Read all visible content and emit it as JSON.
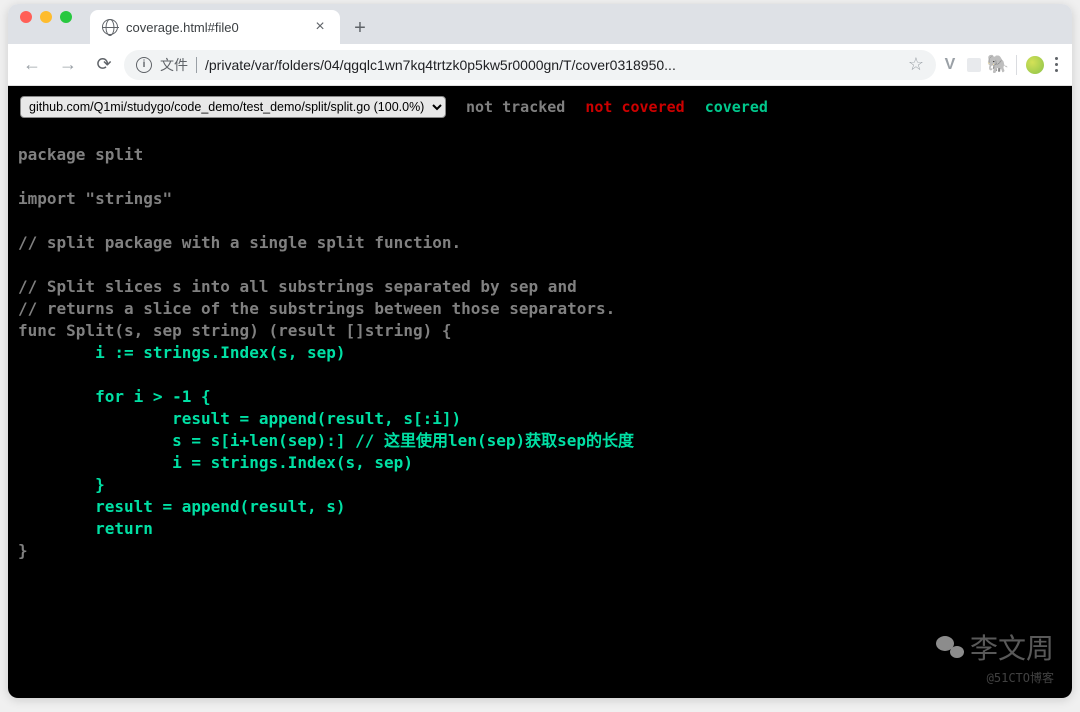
{
  "browser": {
    "tab_title": "coverage.html#file0",
    "url_prefix": "文件",
    "url_path": "/private/var/folders/04/qgqlc1wn7kq4trtzk0p5kw5r0000gn/T/cover0318950..."
  },
  "topnav": {
    "file_option": "github.com/Q1mi/studygo/code_demo/test_demo/split/split.go (100.0%)",
    "not_tracked": "not tracked",
    "not_covered": "not covered",
    "covered": "covered"
  },
  "code": {
    "l1": "package split",
    "l2": "",
    "l3": "import \"strings\"",
    "l4": "",
    "l5": "// split package with a single split function.",
    "l6": "",
    "l7": "// Split slices s into all substrings separated by sep and",
    "l8": "// returns a slice of the substrings between those separators.",
    "l9": "func Split(s, sep string) (result []string) {",
    "l10": "        i := strings.Index(s, sep)",
    "l11": "",
    "l12": "        for i > -1 {",
    "l13": "                result = append(result, s[:i])",
    "l14": "                s = s[i+len(sep):] // 这里使用len(sep)获取sep的长度",
    "l15": "                i = strings.Index(s, sep)",
    "l16": "        }",
    "l17": "        result = append(result, s)",
    "l18": "        return",
    "l19": "}"
  },
  "watermark": {
    "name": "李文周",
    "sub": "@51CTO博客"
  }
}
